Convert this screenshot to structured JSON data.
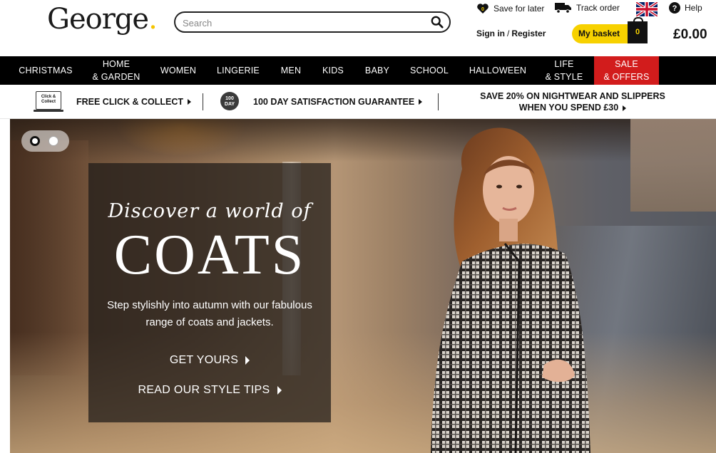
{
  "header": {
    "logo": "George",
    "search_placeholder": "Search",
    "save_for_later": "Save for later",
    "save_count": "0",
    "track_order": "Track order",
    "help": "Help",
    "sign_in": "Sign in",
    "sign_sep": "/",
    "register": "Register",
    "basket_label": "My basket",
    "basket_count": "0",
    "total": "£0.00"
  },
  "nav": {
    "items": [
      {
        "label": "CHRISTMAS"
      },
      {
        "label": "HOME\n& GARDEN"
      },
      {
        "label": "WOMEN"
      },
      {
        "label": "LINGERIE"
      },
      {
        "label": "MEN"
      },
      {
        "label": "KIDS"
      },
      {
        "label": "BABY"
      },
      {
        "label": "SCHOOL"
      },
      {
        "label": "HALLOWEEN"
      },
      {
        "label": "LIFE\n& STYLE"
      },
      {
        "label": "SALE\n& OFFERS"
      }
    ]
  },
  "usp": {
    "click_icon_text": "Click & Collect",
    "click_collect": "FREE CLICK & COLLECT",
    "hundred_icon_text": "100 DAY",
    "guarantee": "100 DAY SATISFACTION GUARANTEE",
    "offer_line1": "SAVE 20% ON NIGHTWEAR AND SLIPPERS",
    "offer_line2": "WHEN YOU SPEND £30"
  },
  "hero": {
    "script": "Discover a world of",
    "title": "COATS",
    "description": "Step stylishly into autumn with our fabulous range of coats and jackets.",
    "cta_primary": "GET YOURS",
    "cta_secondary": "READ OUR STYLE TIPS",
    "slides": 2,
    "active_slide": 1
  },
  "colors": {
    "brand_yellow": "#f7d100",
    "sale_red": "#d21c1c",
    "nav_bg": "#000000"
  }
}
